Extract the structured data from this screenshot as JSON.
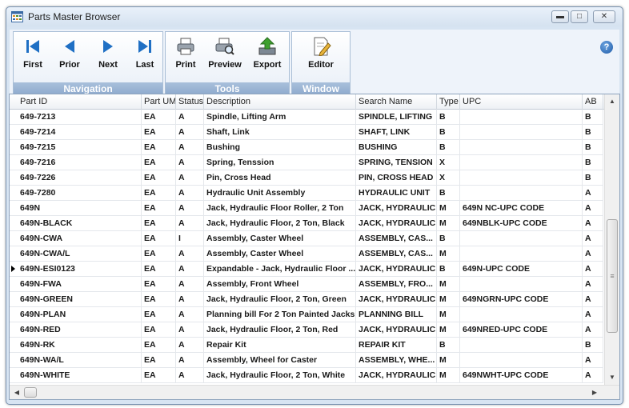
{
  "window": {
    "title": "Parts Master Browser"
  },
  "ribbon": {
    "navigation": {
      "label": "Navigation",
      "buttons": [
        {
          "label": "First",
          "icon": "first-icon"
        },
        {
          "label": "Prior",
          "icon": "prior-icon"
        },
        {
          "label": "Next",
          "icon": "next-icon"
        },
        {
          "label": "Last",
          "icon": "last-icon"
        }
      ]
    },
    "tools": {
      "label": "Tools",
      "buttons": [
        {
          "label": "Print",
          "icon": "print-icon"
        },
        {
          "label": "Preview",
          "icon": "preview-icon"
        },
        {
          "label": "Export",
          "icon": "export-icon"
        }
      ]
    },
    "window_group": {
      "label": "Window",
      "buttons": [
        {
          "label": "Editor",
          "icon": "editor-icon"
        }
      ]
    },
    "help": "?"
  },
  "grid": {
    "columns": [
      "Part ID",
      "Part UM",
      "Status",
      "Description",
      "Search Name",
      "Type",
      "UPC",
      "AB"
    ],
    "selected_row": 10,
    "rows": [
      [
        "649-7213",
        "EA",
        "A",
        "Spindle, Lifting Arm",
        "SPINDLE, LIFTING",
        "B",
        "",
        "B"
      ],
      [
        "649-7214",
        "EA",
        "A",
        "Shaft, Link",
        "SHAFT, LINK",
        "B",
        "",
        "B"
      ],
      [
        "649-7215",
        "EA",
        "A",
        "Bushing",
        "BUSHING",
        "B",
        "",
        "B"
      ],
      [
        "649-7216",
        "EA",
        "A",
        "Spring, Tenssion",
        "SPRING, TENSION",
        "X",
        "",
        "B"
      ],
      [
        "649-7226",
        "EA",
        "A",
        "Pin, Cross Head",
        "PIN, CROSS HEAD",
        "X",
        "",
        "B"
      ],
      [
        "649-7280",
        "EA",
        "A",
        "Hydraulic Unit Assembly",
        "HYDRAULIC UNIT",
        "B",
        "",
        "A"
      ],
      [
        "649N",
        "EA",
        "A",
        "Jack, Hydraulic Floor Roller, 2 Ton",
        "JACK, HYDRAULIC",
        "M",
        "649N NC-UPC CODE",
        "A"
      ],
      [
        "649N-BLACK",
        "EA",
        "A",
        "Jack, Hydraulic Floor, 2 Ton, Black",
        "JACK, HYDRAULIC",
        "M",
        "649NBLK-UPC CODE",
        "A"
      ],
      [
        "649N-CWA",
        "EA",
        "I",
        "Assembly, Caster Wheel",
        "ASSEMBLY, CAS...",
        "B",
        "",
        "A"
      ],
      [
        "649N-CWA/L",
        "EA",
        "A",
        "Assembly, Caster Wheel",
        "ASSEMBLY, CAS...",
        "M",
        "",
        "A"
      ],
      [
        "649N-ESI0123",
        "EA",
        "A",
        "Expandable - Jack, Hydraulic Floor ...",
        "JACK, HYDRAULIC",
        "B",
        "649N-UPC CODE",
        "A"
      ],
      [
        "649N-FWA",
        "EA",
        "A",
        "Assembly, Front Wheel",
        "ASSEMBLY, FRO...",
        "M",
        "",
        "A"
      ],
      [
        "649N-GREEN",
        "EA",
        "A",
        "Jack, Hydraulic Floor, 2 Ton, Green",
        "JACK, HYDRAULIC",
        "M",
        "649NGRN-UPC CODE",
        "A"
      ],
      [
        "649N-PLAN",
        "EA",
        "A",
        "Planning bill For 2 Ton Painted Jacks",
        "PLANNING BILL",
        "M",
        "",
        "A"
      ],
      [
        "649N-RED",
        "EA",
        "A",
        "Jack, Hydraulic Floor, 2 Ton, Red",
        "JACK, HYDRAULIC",
        "M",
        "649NRED-UPC CODE",
        "A"
      ],
      [
        "649N-RK",
        "EA",
        "A",
        "Repair Kit",
        "REPAIR KIT",
        "B",
        "",
        "B"
      ],
      [
        "649N-WA/L",
        "EA",
        "A",
        "Assembly, Wheel for Caster",
        "ASSEMBLY, WHE...",
        "M",
        "",
        "A"
      ],
      [
        "649N-WHITE",
        "EA",
        "A",
        "Jack, Hydraulic Floor, 2 Ton, White",
        "JACK, HYDRAULIC",
        "M",
        "649NWHT-UPC CODE",
        "A"
      ]
    ]
  }
}
